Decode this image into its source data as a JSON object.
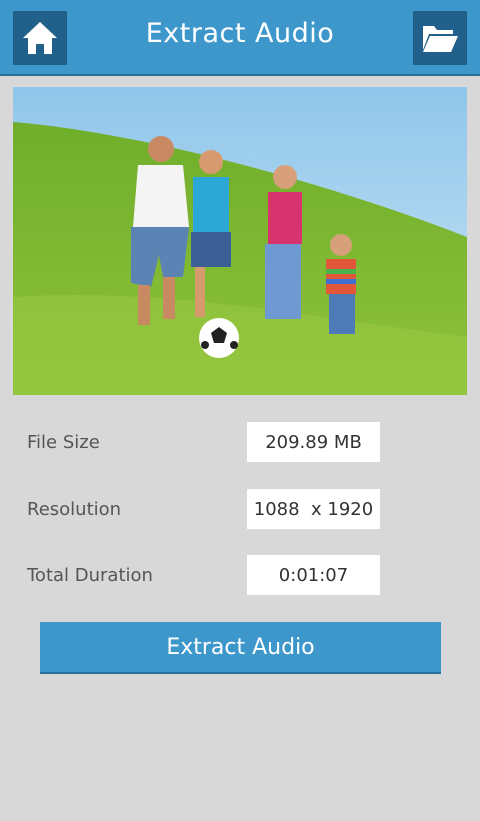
{
  "header": {
    "title": "Extract Audio",
    "home_icon": "home-icon",
    "folder_icon": "folder-open-icon",
    "bar_color": "#3d97cb",
    "icon_bg_color": "#20608b"
  },
  "preview": {
    "image": "family-playing-soccer-photo"
  },
  "info": {
    "file_size_label": "File Size",
    "file_size_value": "209.89 MB",
    "resolution_label": "Resolution",
    "resolution_value": "1088  x 1920",
    "duration_label": "Total Duration",
    "duration_value": "0:01:07"
  },
  "action": {
    "extract_label": "Extract Audio"
  }
}
